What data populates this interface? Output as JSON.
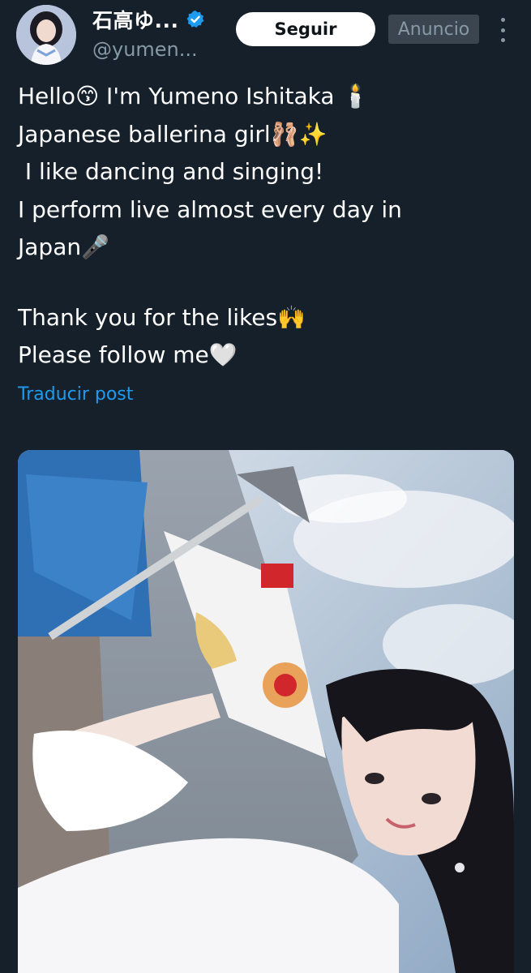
{
  "header": {
    "display_name": "石高ゆ...",
    "handle": "@yumen...",
    "follow_label": "Seguir",
    "ad_label": "Anuncio",
    "verified_icon": "verified-badge-icon",
    "more_icon": "more-options-icon"
  },
  "post": {
    "lines": [
      "Hello😙 I'm Yumeno Ishitaka 🕯️",
      "Japanese ballerina girl🩰✨",
      " I like dancing and singing!",
      "I perform live almost every day in",
      "Japan🎤",
      "",
      "Thank you for the likes🙌",
      "Please follow me🤍"
    ],
    "translate_label": "Traducir post"
  },
  "colors": {
    "background": "#15202b",
    "link": "#1d9bf0",
    "verified": "#1d9bf0",
    "muted": "#8899a6"
  }
}
